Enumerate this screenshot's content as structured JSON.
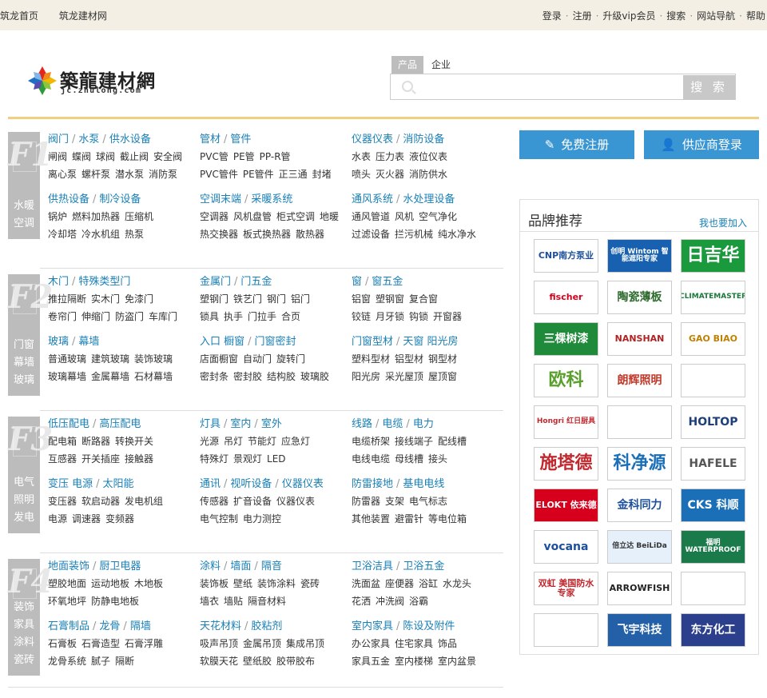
{
  "topbar": {
    "left_links": [
      "筑龙首页",
      "筑龙建材网"
    ],
    "right_links": [
      "登录",
      "注册",
      "升级vip会员",
      "搜索",
      "网站导航",
      "帮助"
    ]
  },
  "logo": {
    "cn": "築龍建材網",
    "en": "jc.zhulong.com"
  },
  "search": {
    "tabs": [
      "产品",
      "企业"
    ],
    "active_tab": "产品",
    "placeholder": "",
    "button": "搜 索"
  },
  "floors": [
    {
      "num": "F1",
      "name": [
        "水暖",
        "空调"
      ],
      "cats": [
        {
          "title": [
            "阀门",
            "水泵",
            "供水设备"
          ],
          "rows": [
            [
              "闸阀",
              "蝶阀",
              "球阀",
              "截止阀",
              "安全阀"
            ],
            [
              "离心泵",
              "螺杆泵",
              "潜水泵",
              "消防泵"
            ]
          ]
        },
        {
          "title": [
            "管材",
            "管件"
          ],
          "rows": [
            [
              "PVC管",
              "PE管",
              "PP-R管"
            ],
            [
              "PVC管件",
              "PE管件",
              "正三通",
              "封堵"
            ]
          ]
        },
        {
          "title": [
            "仪器仪表",
            "消防设备"
          ],
          "rows": [
            [
              "水表",
              "压力表",
              "液位仪表"
            ],
            [
              "喷头",
              "灭火器",
              "消防供水"
            ]
          ]
        },
        {
          "title": [
            "供热设备",
            "制冷设备"
          ],
          "rows": [
            [
              "锅炉",
              "燃料加热器",
              "压缩机"
            ],
            [
              "冷却塔",
              "冷水机组",
              "热泵"
            ]
          ]
        },
        {
          "title": [
            "空调末端",
            "采暖系统"
          ],
          "rows": [
            [
              "空调器",
              "风机盘管",
              "柜式空调",
              "地暖"
            ],
            [
              "热交换器",
              "板式换热器",
              "散热器"
            ]
          ]
        },
        {
          "title": [
            "通风系统",
            "水处理设备"
          ],
          "rows": [
            [
              "通风管道",
              "风机",
              "空气净化"
            ],
            [
              "过滤设备",
              "拦污机械",
              "纯水净水"
            ]
          ]
        }
      ]
    },
    {
      "num": "F2",
      "name": [
        "门窗",
        "幕墙",
        "玻璃"
      ],
      "cats": [
        {
          "title": [
            "木门",
            "特殊类型门"
          ],
          "rows": [
            [
              "推拉隔断",
              "实木门",
              "免漆门"
            ],
            [
              "卷帘门",
              "伸缩门",
              "防盗门",
              "车库门"
            ]
          ]
        },
        {
          "title": [
            "金属门",
            "门五金"
          ],
          "rows": [
            [
              "塑钢门",
              "铁艺门",
              "钢门",
              "铝门"
            ],
            [
              "锁具",
              "执手",
              "门拉手",
              "合页"
            ]
          ]
        },
        {
          "title": [
            "窗",
            "窗五金"
          ],
          "rows": [
            [
              "铝窗",
              "塑钢窗",
              "复合窗"
            ],
            [
              "铰链",
              "月牙锁",
              "钩锁",
              "开窗器"
            ]
          ]
        },
        {
          "title": [
            "玻璃",
            "幕墙"
          ],
          "rows": [
            [
              "普通玻璃",
              "建筑玻璃",
              "装饰玻璃"
            ],
            [
              "玻璃幕墙",
              "金属幕墙",
              "石材幕墙"
            ]
          ]
        },
        {
          "title": [
            "入口 橱窗",
            "门窗密封"
          ],
          "rows": [
            [
              "店面橱窗",
              "自动门",
              "旋转门"
            ],
            [
              "密封条",
              "密封胶",
              "结构胶",
              "玻璃胶"
            ]
          ]
        },
        {
          "title": [
            "门窗型材",
            "天窗 阳光房"
          ],
          "rows": [
            [
              "塑料型材",
              "铝型材",
              "钢型材"
            ],
            [
              "阳光房",
              "采光屋顶",
              "屋顶窗"
            ]
          ]
        }
      ]
    },
    {
      "num": "F3",
      "name": [
        "电气",
        "照明",
        "发电"
      ],
      "cats": [
        {
          "title": [
            "低压配电",
            "高压配电"
          ],
          "rows": [
            [
              "配电箱",
              "断路器",
              "转换开关"
            ],
            [
              "互感器",
              "开关插座",
              "接触器"
            ]
          ]
        },
        {
          "title": [
            "灯具",
            "室内",
            "室外"
          ],
          "rows": [
            [
              "光源",
              "吊灯",
              "节能灯",
              "应急灯"
            ],
            [
              "特殊灯",
              "景观灯",
              "LED"
            ]
          ]
        },
        {
          "title": [
            "线路",
            "电缆",
            "电力"
          ],
          "rows": [
            [
              "电缆桥架",
              "接线端子",
              "配线槽"
            ],
            [
              "电线电缆",
              "母线槽",
              "接头"
            ]
          ]
        },
        {
          "title": [
            "变压 电源",
            "太阳能"
          ],
          "rows": [
            [
              "变压器",
              "软启动器",
              "发电机组"
            ],
            [
              "电源",
              "调速器",
              "变频器"
            ]
          ]
        },
        {
          "title": [
            "通讯",
            "视听设备",
            "仪器仪表"
          ],
          "rows": [
            [
              "传感器",
              "扩音设备",
              "仪器仪表"
            ],
            [
              "电气控制",
              "电力测控"
            ]
          ]
        },
        {
          "title": [
            "防雷接地",
            "基电电线"
          ],
          "rows": [
            [
              "防雷器",
              "支架",
              "电气标志"
            ],
            [
              "其他装置",
              "避雷针",
              "等电位箱"
            ]
          ]
        }
      ]
    },
    {
      "num": "F4",
      "name": [
        "装饰",
        "家具",
        "涂料",
        "瓷砖"
      ],
      "cats": [
        {
          "title": [
            "地面装饰",
            "厨卫电器"
          ],
          "rows": [
            [
              "塑胶地面",
              "运动地板",
              "木地板"
            ],
            [
              "环氧地坪",
              "防静电地板"
            ]
          ]
        },
        {
          "title": [
            "涂料",
            "墙面",
            "隔音"
          ],
          "rows": [
            [
              "装饰板",
              "壁纸",
              "装饰涂料",
              "瓷砖"
            ],
            [
              "墙衣",
              "墙贴",
              "隔音材料"
            ]
          ]
        },
        {
          "title": [
            "卫浴洁具",
            "卫浴五金"
          ],
          "rows": [
            [
              "洗面盆",
              "座便器",
              "浴缸",
              "水龙头"
            ],
            [
              "花洒",
              "冲洗阀",
              "浴霸"
            ]
          ]
        },
        {
          "title": [
            "石膏制品",
            "龙骨",
            "隔墙"
          ],
          "rows": [
            [
              "石膏板",
              "石膏造型",
              "石膏浮雕"
            ],
            [
              "龙骨系统",
              "腻子",
              "隔断"
            ]
          ]
        },
        {
          "title": [
            "天花材料",
            "胶粘剂"
          ],
          "rows": [
            [
              "吸声吊顶",
              "金属吊顶",
              "集成吊顶"
            ],
            [
              "软膜天花",
              "壁纸胶",
              "胶带胶布"
            ]
          ]
        },
        {
          "title": [
            "室内家具",
            "陈设及附件"
          ],
          "rows": [
            [
              "办公家具",
              "住宅家具",
              "饰品"
            ],
            [
              "家具五金",
              "室内楼梯",
              "室内盆景"
            ]
          ]
        }
      ]
    }
  ],
  "register_button": "免费注册",
  "supplier_login_button": "供应商登录",
  "brands": {
    "title": "品牌推荐",
    "join": "我也要加入",
    "logos": [
      {
        "text": "CNP南方泵业",
        "color": "#1d4f9c",
        "bg": "#ffffff"
      },
      {
        "text": "创明 Wintom 智能遮阳专家",
        "color": "#ffffff",
        "bg": "#1761b0"
      },
      {
        "text": "日吉华",
        "color": "#ffffff",
        "bg": "#1a9a3c"
      },
      {
        "text": "fischer",
        "color": "#d6001c",
        "bg": "#ffffff"
      },
      {
        "text": "陶瓷薄板",
        "color": "#2e6b2e",
        "bg": "#ffffff"
      },
      {
        "text": "CLIMATEMASTER",
        "color": "#1a7a3a",
        "bg": "#ffffff"
      },
      {
        "text": "三棵树漆",
        "color": "#ffffff",
        "bg": "#1f8a3a"
      },
      {
        "text": "NANSHAN",
        "color": "#b22222",
        "bg": "#ffffff"
      },
      {
        "text": "GAO BIAO",
        "color": "#c08000",
        "bg": "#ffffff"
      },
      {
        "text": "欧科",
        "color": "#5aa02c",
        "bg": "#ffffff"
      },
      {
        "text": "朗辉照明",
        "color": "#c0392b",
        "bg": "#ffffff"
      },
      {
        "text": "",
        "color": "#2a7fc1",
        "bg": "#ffffff"
      },
      {
        "text": "Hongri 红日厨具",
        "color": "#c0282e",
        "bg": "#ffffff"
      },
      {
        "text": "",
        "color": "#1d4f9c",
        "bg": "#ffffff"
      },
      {
        "text": "HOLTOP",
        "color": "#1d3f7a",
        "bg": "#ffffff"
      },
      {
        "text": "施塔德",
        "color": "#c0282e",
        "bg": "#ffffff"
      },
      {
        "text": "科净源",
        "color": "#1a6fb6",
        "bg": "#ffffff"
      },
      {
        "text": "HAFELE",
        "color": "#555555",
        "bg": "#ffffff"
      },
      {
        "text": "ELOKT 依来德",
        "color": "#ffffff",
        "bg": "#d6001c"
      },
      {
        "text": "金科同力",
        "color": "#1d4f9c",
        "bg": "#ffffff"
      },
      {
        "text": "CKS 科顺",
        "color": "#ffffff",
        "bg": "#1a6fb6"
      },
      {
        "text": "vocana",
        "color": "#1d4f9c",
        "bg": "#ffffff"
      },
      {
        "text": "倍立达 BeiLiDa",
        "color": "#333333",
        "bg": "#e6f0fa"
      },
      {
        "text": "福明 WATERPROOF",
        "color": "#ffffff",
        "bg": "#1a7a4a"
      },
      {
        "text": "双虹 美国防水专家",
        "color": "#c0282e",
        "bg": "#ffffff"
      },
      {
        "text": "ARROWFISH",
        "color": "#222222",
        "bg": "#ffffff"
      },
      {
        "text": "",
        "color": "#333333",
        "bg": "#ffffff"
      },
      {
        "text": "",
        "color": "#c0282e",
        "bg": "#ffffff"
      },
      {
        "text": "飞宇科技",
        "color": "#ffffff",
        "bg": "#2460a8"
      },
      {
        "text": "东方化工",
        "color": "#ffffff",
        "bg": "#2b3f8c"
      }
    ]
  }
}
